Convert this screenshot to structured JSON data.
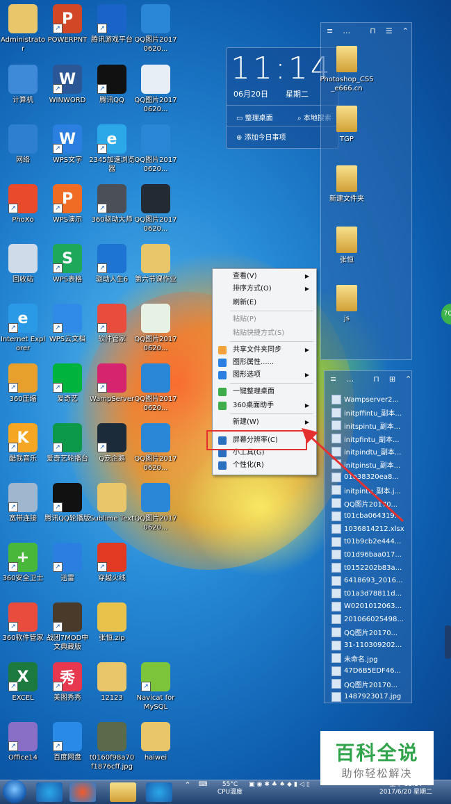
{
  "desktop_icons": [
    {
      "label": "Administrator",
      "glyph": "",
      "color": "#e9c66a",
      "shortcut": false
    },
    {
      "label": "POWERPNT",
      "glyph": "P",
      "color": "#d24726",
      "shortcut": true
    },
    {
      "label": "腾讯游戏平台",
      "glyph": "",
      "color": "#1a63c8",
      "shortcut": true
    },
    {
      "label": "QQ图片20170620...",
      "glyph": "",
      "color": "#2a86d6",
      "shortcut": false
    },
    {
      "label": "计算机",
      "glyph": "",
      "color": "#3f8ad8",
      "shortcut": false
    },
    {
      "label": "WINWORD",
      "glyph": "W",
      "color": "#2b5797",
      "shortcut": true
    },
    {
      "label": "腾讯QQ",
      "glyph": "",
      "color": "#111111",
      "shortcut": true
    },
    {
      "label": "QQ图片20170620...",
      "glyph": "",
      "color": "#e8eef6",
      "shortcut": false
    },
    {
      "label": "网络",
      "glyph": "",
      "color": "#2f7fd0",
      "shortcut": false
    },
    {
      "label": "WPS文字",
      "glyph": "W",
      "color": "#2a7fe0",
      "shortcut": true
    },
    {
      "label": "2345加速浏览器",
      "glyph": "e",
      "color": "#2aa8e8",
      "shortcut": true
    },
    {
      "label": "QQ图片20170620...",
      "glyph": "",
      "color": "#2a86d6",
      "shortcut": false
    },
    {
      "label": "PhoXo",
      "glyph": "",
      "color": "#e84a2b",
      "shortcut": true
    },
    {
      "label": "WPS演示",
      "glyph": "P",
      "color": "#f06b24",
      "shortcut": true
    },
    {
      "label": "360驱动大师",
      "glyph": "",
      "color": "#4a4f58",
      "shortcut": true
    },
    {
      "label": "QQ图片20170620...",
      "glyph": "",
      "color": "#222a33",
      "shortcut": false
    },
    {
      "label": "回收站",
      "glyph": "",
      "color": "#cfdbe8",
      "shortcut": false
    },
    {
      "label": "WPS表格",
      "glyph": "S",
      "color": "#1ea85a",
      "shortcut": true
    },
    {
      "label": "驱动人生6",
      "glyph": "",
      "color": "#1d74d2",
      "shortcut": true
    },
    {
      "label": "第六节课作业",
      "glyph": "",
      "color": "#e9c66a",
      "shortcut": false
    },
    {
      "label": "Internet Explorer",
      "glyph": "e",
      "color": "#2a9ae6",
      "shortcut": true
    },
    {
      "label": "WPS云文档",
      "glyph": "",
      "color": "#2f8ae8",
      "shortcut": true
    },
    {
      "label": "软件管家",
      "glyph": "",
      "color": "#e94b3c",
      "shortcut": true
    },
    {
      "label": "QQ图片20170620...",
      "glyph": "",
      "color": "#e8f2e4",
      "shortcut": false
    },
    {
      "label": "360压缩",
      "glyph": "",
      "color": "#e8a02c",
      "shortcut": true
    },
    {
      "label": "爱奇艺",
      "glyph": "",
      "color": "#00b33c",
      "shortcut": true
    },
    {
      "label": "WampServer",
      "glyph": "",
      "color": "#d6246e",
      "shortcut": true
    },
    {
      "label": "QQ图片20170620...",
      "glyph": "",
      "color": "#2a86d6",
      "shortcut": false
    },
    {
      "label": "酷我音乐",
      "glyph": "K",
      "color": "#f5a623",
      "shortcut": true
    },
    {
      "label": "爱奇艺轮播台",
      "glyph": "",
      "color": "#0c9a4a",
      "shortcut": true
    },
    {
      "label": "Q宠企鹅",
      "glyph": "",
      "color": "#1b2b3a",
      "shortcut": true
    },
    {
      "label": "QQ图片20170620...",
      "glyph": "",
      "color": "#2a86d6",
      "shortcut": false
    },
    {
      "label": "宽带连接",
      "glyph": "",
      "color": "#9fb6cf",
      "shortcut": true
    },
    {
      "label": "腾讯QQ轮播版",
      "glyph": "",
      "color": "#111111",
      "shortcut": true
    },
    {
      "label": "Sublime Text",
      "glyph": "",
      "color": "#e9c66a",
      "shortcut": false
    },
    {
      "label": "QQ图片20170620...",
      "glyph": "",
      "color": "#2a86d6",
      "shortcut": false
    },
    {
      "label": "360安全卫士",
      "glyph": "+",
      "color": "#49b83a",
      "shortcut": true
    },
    {
      "label": "迅雷",
      "glyph": "",
      "color": "#2a7fe0",
      "shortcut": true
    },
    {
      "label": "穿越火线",
      "glyph": "",
      "color": "#e23a22",
      "shortcut": true
    },
    {
      "label": "",
      "glyph": "",
      "color": "transparent",
      "shortcut": false
    },
    {
      "label": "360软件管家",
      "glyph": "",
      "color": "#e94b3c",
      "shortcut": true
    },
    {
      "label": "战团7MOD中文典藏版",
      "glyph": "",
      "color": "#4a3a2a",
      "shortcut": true
    },
    {
      "label": "张恒.zip",
      "glyph": "",
      "color": "#e8c24a",
      "shortcut": false
    },
    {
      "label": "",
      "glyph": "",
      "color": "transparent",
      "shortcut": false
    },
    {
      "label": "EXCEL",
      "glyph": "X",
      "color": "#1d7a3f",
      "shortcut": true
    },
    {
      "label": "美图秀秀",
      "glyph": "秀",
      "color": "#e8384f",
      "shortcut": true
    },
    {
      "label": "12123",
      "glyph": "",
      "color": "#e9c66a",
      "shortcut": false
    },
    {
      "label": "Navicat for MySQL",
      "glyph": "",
      "color": "#7cc43a",
      "shortcut": true
    },
    {
      "label": "Office14",
      "glyph": "",
      "color": "#8a6fc7",
      "shortcut": true
    },
    {
      "label": "百度网盘",
      "glyph": "",
      "color": "#2a8ae8",
      "shortcut": true
    },
    {
      "label": "t0160f98a70f1876cff.jpg",
      "glyph": "",
      "color": "#5a6a4a",
      "shortcut": false
    },
    {
      "label": "haiwei",
      "glyph": "",
      "color": "#e9c66a",
      "shortcut": false
    }
  ],
  "clock": {
    "time": "11:14",
    "date": "06月20日",
    "weekday": "星期二",
    "btn_organize": "整理桌面",
    "btn_search": "本地搜索",
    "btn_add_todo": "添加今日事项"
  },
  "fence_top": {
    "items": [
      {
        "label": "Photoshop_CS5_e666.cn"
      },
      {
        "label": "TGP"
      },
      {
        "label": "新建文件夹"
      },
      {
        "label": "张恒"
      },
      {
        "label": "js"
      }
    ]
  },
  "fence_bottom": {
    "items": [
      "Wampserver2...",
      "initpffintu_副本...",
      "initspintu_副本...",
      "initpfintu_副本...",
      "initpindtu_副本...",
      "initpinstu_副本...",
      "01a38320ea8...",
      "initpintu_副本.j...",
      "QQ图片20170...",
      "t01cba064319...",
      "1036814212.xlsx",
      "t01b9cb2e444...",
      "t01d96baa017...",
      "t0152202b83a...",
      "6418693_2016...",
      "t01a3d78811d...",
      "W0201012063...",
      "201066025498...",
      "QQ图片20170...",
      "31-110309202...",
      "未命名.jpg",
      "47D6B5EDF46...",
      "QQ图片20170...",
      "1487923017.jpg"
    ]
  },
  "context_menu": {
    "items": [
      {
        "label": "查看(V)",
        "submenu": true,
        "disabled": false,
        "icon": ""
      },
      {
        "label": "排序方式(O)",
        "submenu": true,
        "disabled": false,
        "icon": ""
      },
      {
        "label": "刷新(E)",
        "submenu": false,
        "disabled": false,
        "icon": ""
      },
      {
        "label": "粘贴(P)",
        "submenu": false,
        "disabled": true,
        "icon": ""
      },
      {
        "label": "粘贴快捷方式(S)",
        "submenu": false,
        "disabled": true,
        "icon": ""
      },
      {
        "label": "共享文件夹同步",
        "submenu": true,
        "disabled": false,
        "icon": "#f2a33a"
      },
      {
        "label": "图形属性......",
        "submenu": false,
        "disabled": false,
        "icon": "#2a7fe0"
      },
      {
        "label": "图形选项",
        "submenu": true,
        "disabled": false,
        "icon": "#2a7fe0"
      },
      {
        "label": "一键整理桌面",
        "submenu": false,
        "disabled": false,
        "icon": "#3fae4a"
      },
      {
        "label": "360桌面助手",
        "submenu": true,
        "disabled": false,
        "icon": "#3fae4a"
      },
      {
        "label": "新建(W)",
        "submenu": true,
        "disabled": false,
        "icon": ""
      },
      {
        "label": "屏幕分辨率(C)",
        "submenu": false,
        "disabled": false,
        "icon": "#2a6fc0"
      },
      {
        "label": "小工具(G)",
        "submenu": false,
        "disabled": false,
        "icon": "#2a6fc0"
      },
      {
        "label": "个性化(R)",
        "submenu": false,
        "disabled": false,
        "icon": "#2a6fc0"
      }
    ]
  },
  "gadget_badge": "70",
  "taskbar": {
    "temp": "55°C",
    "temp_label": "CPU温度",
    "time": "上午 11:14",
    "date": "2017/6/20 星期二"
  },
  "watermark": {
    "title": "百科全说",
    "subtitle": "助你轻松解决"
  },
  "colors": {
    "highlight_border": "#e53030",
    "watermark_green": "#2fa44a"
  }
}
